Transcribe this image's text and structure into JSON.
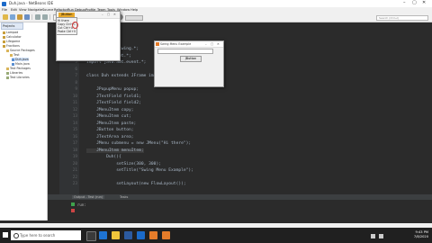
{
  "ide": {
    "title": "Duh.java - NetBeans IDE",
    "menu": [
      "File",
      "Edit",
      "View",
      "Navigate",
      "Source",
      "Refactor",
      "Run",
      "Debug",
      "Profile",
      "Team",
      "Tools",
      "Window",
      "Help"
    ],
    "search_placeholder": "Search (Ctrl+I)"
  },
  "project_panel": {
    "tab": "Projects",
    "tree": [
      "Lampad",
      "Calculator",
      "Lifegame",
      "Fractions",
      "Source Packages",
      "Test",
      "Duh.java",
      "Main.java",
      "Test Packages",
      "Libraries",
      "Test Libraries"
    ]
  },
  "editor": {
    "line_numbers": [
      "1",
      "2",
      "3",
      "4",
      "5",
      "6",
      "7",
      "8",
      "9",
      "10",
      "11",
      "12",
      "13",
      "14",
      "15",
      "16",
      "17",
      "18",
      "19",
      "20",
      "21",
      "22",
      "23",
      "24",
      "25",
      "26",
      "27",
      "28"
    ],
    "lines": [
      {
        "t": "package test;"
      },
      {
        "t": ""
      },
      {
        "t": "import javax.swing.*;"
      },
      {
        "t": "import java.awt.*;"
      },
      {
        "t": "import java.awt.event.*;"
      },
      {
        "t": ""
      },
      {
        "t": "class Duh extends JFrame implements ActionListener{"
      },
      {
        "t": ""
      },
      {
        "t": "    JPopupMenu popup;"
      },
      {
        "t": "    JTextField field1;"
      },
      {
        "t": "    JTextField field2;"
      },
      {
        "t": "    JMenuItem copy;"
      },
      {
        "t": "    JMenuItem cut;"
      },
      {
        "t": "    JMenuItem paste;"
      },
      {
        "t": "    JButton button;"
      },
      {
        "t": "    JTextArea area;"
      },
      {
        "t": "    JMenu submenu = new JMenu(\"Hi there\");"
      },
      {
        "t": "    JMenuItem menuItem;"
      },
      {
        "t": "        Duh(){"
      },
      {
        "t": "            setSize(300, 300);"
      },
      {
        "t": "            setTitle(\"Swing Menu Example\");"
      },
      {
        "t": ""
      },
      {
        "t": "            setLayout(new FlowLayout());"
      }
    ]
  },
  "output": {
    "tabs": [
      "Output - Test (run)",
      "Tasks"
    ],
    "text": "run:"
  },
  "popup_window": {
    "button": "JButton",
    "menu_items": [
      "Hi there",
      "Copy  Ctrl+C",
      "Cut   Ctrl+X",
      "Paste Ctrl+V"
    ]
  },
  "swing_window": {
    "title": "Swing Menu Example",
    "button": "JButton"
  },
  "taskbar": {
    "search_placeholder": "Type here to search",
    "time": "9:43 PM",
    "date": "7/8/2020"
  },
  "colors": {
    "editor_bg": "#2b2b2b",
    "keyword": "#cc7832",
    "string": "#6a8759",
    "accent": "#e8a92a"
  }
}
